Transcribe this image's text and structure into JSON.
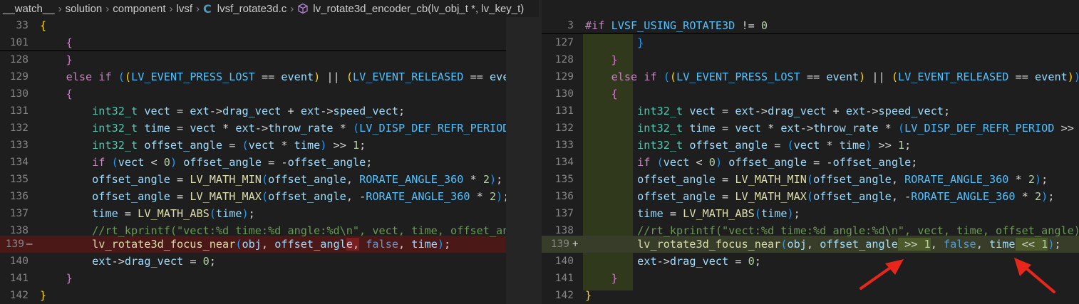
{
  "breadcrumb": {
    "items": [
      "__watch__",
      "solution",
      "component",
      "lvsf",
      "lvsf_rotate3d.c",
      "lv_rotate3d_encoder_cb(lv_obj_t *, lv_key_t)"
    ]
  },
  "left": {
    "line_numbers": [
      "33",
      "101",
      "128",
      "129",
      "130",
      "131",
      "132",
      "133",
      "134",
      "135",
      "136",
      "137",
      "138",
      "139",
      "140",
      "141",
      "142"
    ],
    "removed_marker": "—"
  },
  "right": {
    "line_numbers": [
      "3",
      "127",
      "128",
      "129",
      "130",
      "131",
      "132",
      "133",
      "134",
      "135",
      "136",
      "137",
      "138",
      "139",
      "140",
      "141",
      "142"
    ],
    "added_marker": "+"
  },
  "colors": {
    "removed": "#4b1818",
    "added": "#373d29",
    "arrow": "#e8261b"
  },
  "icons": {
    "file": "c-file-icon",
    "symbol": "cube-icon"
  }
}
